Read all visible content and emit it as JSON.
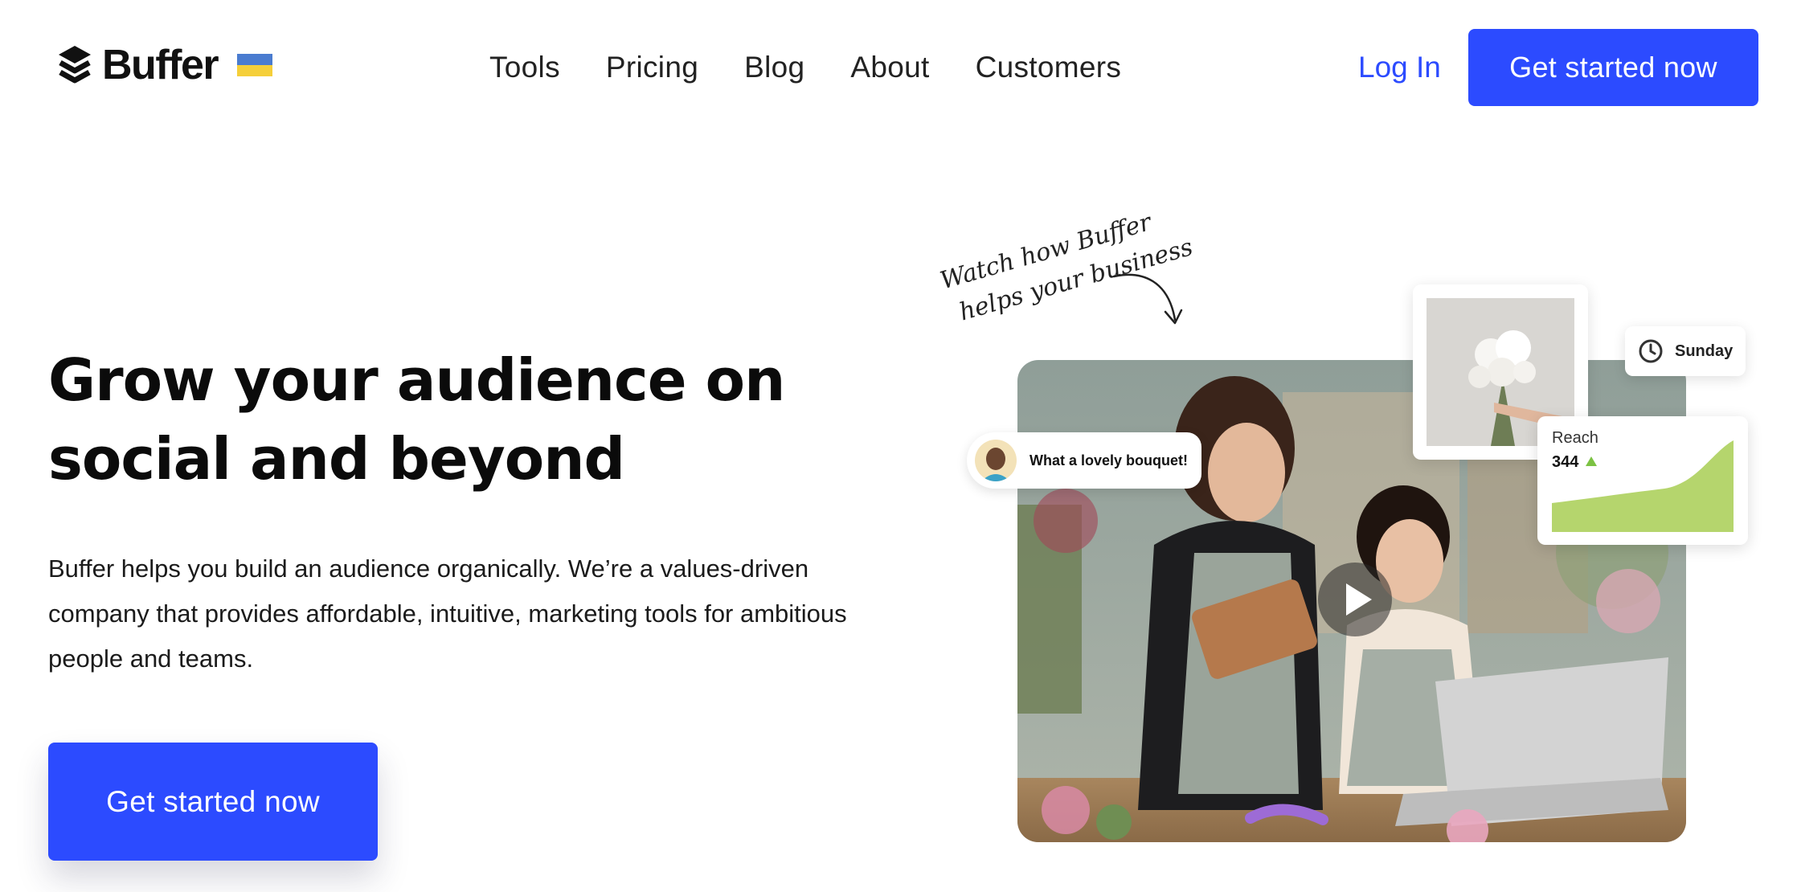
{
  "brand": {
    "name": "Buffer",
    "flag": "ukraine-flag"
  },
  "nav": {
    "items": [
      "Tools",
      "Pricing",
      "Blog",
      "About",
      "Customers"
    ]
  },
  "header": {
    "login_label": "Log In",
    "cta_label": "Get started now"
  },
  "hero": {
    "title": "Grow your audience on social and beyond",
    "description": "Buffer helps you build an audience organically. We’re a values-driven company that provides affordable, intuitive, marketing tools for ambitious people and teams.",
    "cta_label": "Get started now"
  },
  "media": {
    "handwritten_line1": "Watch how Buffer",
    "handwritten_line2": "helps your business",
    "comment": "What a lovely bouquet!",
    "day": "Sunday",
    "reach_label": "Reach",
    "reach_value": "344",
    "play_icon": "play-icon"
  },
  "colors": {
    "accent": "#2c4bff",
    "chart_green": "#b5d56d",
    "trend_up": "#7cc243"
  }
}
